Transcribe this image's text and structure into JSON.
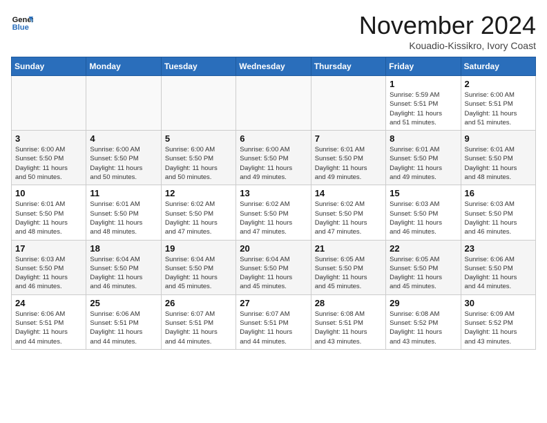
{
  "header": {
    "logo_line1": "General",
    "logo_line2": "Blue",
    "month": "November 2024",
    "location": "Kouadio-Kissikro, Ivory Coast"
  },
  "weekdays": [
    "Sunday",
    "Monday",
    "Tuesday",
    "Wednesday",
    "Thursday",
    "Friday",
    "Saturday"
  ],
  "weeks": [
    [
      {
        "day": "",
        "info": ""
      },
      {
        "day": "",
        "info": ""
      },
      {
        "day": "",
        "info": ""
      },
      {
        "day": "",
        "info": ""
      },
      {
        "day": "",
        "info": ""
      },
      {
        "day": "1",
        "info": "Sunrise: 5:59 AM\nSunset: 5:51 PM\nDaylight: 11 hours\nand 51 minutes."
      },
      {
        "day": "2",
        "info": "Sunrise: 6:00 AM\nSunset: 5:51 PM\nDaylight: 11 hours\nand 51 minutes."
      }
    ],
    [
      {
        "day": "3",
        "info": "Sunrise: 6:00 AM\nSunset: 5:50 PM\nDaylight: 11 hours\nand 50 minutes."
      },
      {
        "day": "4",
        "info": "Sunrise: 6:00 AM\nSunset: 5:50 PM\nDaylight: 11 hours\nand 50 minutes."
      },
      {
        "day": "5",
        "info": "Sunrise: 6:00 AM\nSunset: 5:50 PM\nDaylight: 11 hours\nand 50 minutes."
      },
      {
        "day": "6",
        "info": "Sunrise: 6:00 AM\nSunset: 5:50 PM\nDaylight: 11 hours\nand 49 minutes."
      },
      {
        "day": "7",
        "info": "Sunrise: 6:01 AM\nSunset: 5:50 PM\nDaylight: 11 hours\nand 49 minutes."
      },
      {
        "day": "8",
        "info": "Sunrise: 6:01 AM\nSunset: 5:50 PM\nDaylight: 11 hours\nand 49 minutes."
      },
      {
        "day": "9",
        "info": "Sunrise: 6:01 AM\nSunset: 5:50 PM\nDaylight: 11 hours\nand 48 minutes."
      }
    ],
    [
      {
        "day": "10",
        "info": "Sunrise: 6:01 AM\nSunset: 5:50 PM\nDaylight: 11 hours\nand 48 minutes."
      },
      {
        "day": "11",
        "info": "Sunrise: 6:01 AM\nSunset: 5:50 PM\nDaylight: 11 hours\nand 48 minutes."
      },
      {
        "day": "12",
        "info": "Sunrise: 6:02 AM\nSunset: 5:50 PM\nDaylight: 11 hours\nand 47 minutes."
      },
      {
        "day": "13",
        "info": "Sunrise: 6:02 AM\nSunset: 5:50 PM\nDaylight: 11 hours\nand 47 minutes."
      },
      {
        "day": "14",
        "info": "Sunrise: 6:02 AM\nSunset: 5:50 PM\nDaylight: 11 hours\nand 47 minutes."
      },
      {
        "day": "15",
        "info": "Sunrise: 6:03 AM\nSunset: 5:50 PM\nDaylight: 11 hours\nand 46 minutes."
      },
      {
        "day": "16",
        "info": "Sunrise: 6:03 AM\nSunset: 5:50 PM\nDaylight: 11 hours\nand 46 minutes."
      }
    ],
    [
      {
        "day": "17",
        "info": "Sunrise: 6:03 AM\nSunset: 5:50 PM\nDaylight: 11 hours\nand 46 minutes."
      },
      {
        "day": "18",
        "info": "Sunrise: 6:04 AM\nSunset: 5:50 PM\nDaylight: 11 hours\nand 46 minutes."
      },
      {
        "day": "19",
        "info": "Sunrise: 6:04 AM\nSunset: 5:50 PM\nDaylight: 11 hours\nand 45 minutes."
      },
      {
        "day": "20",
        "info": "Sunrise: 6:04 AM\nSunset: 5:50 PM\nDaylight: 11 hours\nand 45 minutes."
      },
      {
        "day": "21",
        "info": "Sunrise: 6:05 AM\nSunset: 5:50 PM\nDaylight: 11 hours\nand 45 minutes."
      },
      {
        "day": "22",
        "info": "Sunrise: 6:05 AM\nSunset: 5:50 PM\nDaylight: 11 hours\nand 45 minutes."
      },
      {
        "day": "23",
        "info": "Sunrise: 6:06 AM\nSunset: 5:50 PM\nDaylight: 11 hours\nand 44 minutes."
      }
    ],
    [
      {
        "day": "24",
        "info": "Sunrise: 6:06 AM\nSunset: 5:51 PM\nDaylight: 11 hours\nand 44 minutes."
      },
      {
        "day": "25",
        "info": "Sunrise: 6:06 AM\nSunset: 5:51 PM\nDaylight: 11 hours\nand 44 minutes."
      },
      {
        "day": "26",
        "info": "Sunrise: 6:07 AM\nSunset: 5:51 PM\nDaylight: 11 hours\nand 44 minutes."
      },
      {
        "day": "27",
        "info": "Sunrise: 6:07 AM\nSunset: 5:51 PM\nDaylight: 11 hours\nand 44 minutes."
      },
      {
        "day": "28",
        "info": "Sunrise: 6:08 AM\nSunset: 5:51 PM\nDaylight: 11 hours\nand 43 minutes."
      },
      {
        "day": "29",
        "info": "Sunrise: 6:08 AM\nSunset: 5:52 PM\nDaylight: 11 hours\nand 43 minutes."
      },
      {
        "day": "30",
        "info": "Sunrise: 6:09 AM\nSunset: 5:52 PM\nDaylight: 11 hours\nand 43 minutes."
      }
    ]
  ]
}
